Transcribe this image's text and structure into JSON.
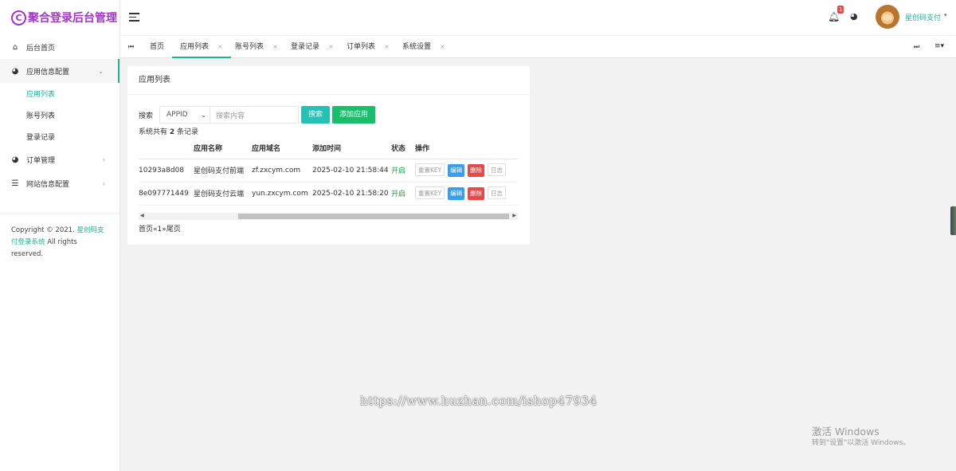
{
  "app": {
    "logo_mark": "C",
    "title": "聚合登录后台管理"
  },
  "sidebar": {
    "items": [
      {
        "label": "后台首页",
        "icon": "home-icon"
      },
      {
        "label": "应用信息配置",
        "icon": "palette-icon",
        "expanded": true
      },
      {
        "label": "订单管理",
        "icon": "palette-icon"
      },
      {
        "label": "网站信息配置",
        "icon": "list-icon"
      }
    ],
    "sub_items": [
      {
        "label": "应用列表",
        "active": true
      },
      {
        "label": "账号列表"
      },
      {
        "label": "登录记录"
      }
    ],
    "copyright_prefix": "Copyright © 2021. ",
    "copyright_link": "星创码支付登录系统",
    "copyright_suffix": " All rights reserved."
  },
  "header": {
    "notification_count": "1",
    "user_name": "星创码支付",
    "user_caret": "▾"
  },
  "tabs": {
    "items": [
      {
        "label": "首页"
      },
      {
        "label": "应用列表",
        "active": true
      },
      {
        "label": "账号列表"
      },
      {
        "label": "登录记录"
      },
      {
        "label": "订单列表"
      },
      {
        "label": "系统设置"
      }
    ]
  },
  "main": {
    "card_title": "应用列表",
    "search_label": "搜索",
    "select_value": "APPID",
    "search_placeholder": "搜索内容",
    "search_button": "搜索",
    "add_button": "添加应用",
    "record_prefix": "系统共有 ",
    "record_count": "2",
    "record_suffix": " 条记录",
    "table": {
      "headers": [
        "",
        "应用名称",
        "应用域名",
        "添加时间",
        "状态",
        "操作"
      ],
      "rows": [
        {
          "appid": "10293a8d08",
          "name": "星创码支付前端",
          "domain": "zf.zxcym.com",
          "time": "2025-02-10 21:58:44",
          "status": "开启"
        },
        {
          "appid": "8e097771449",
          "name": "星创码支付云端",
          "domain": "yun.zxcym.com",
          "time": "2025-02-10 21:58:20",
          "status": "开启"
        }
      ],
      "actions": {
        "reset": "重置KEY",
        "edit": "编辑",
        "delete": "删除",
        "log": "日志"
      }
    },
    "pager": "首页«1»尾页"
  },
  "overlay": {
    "watermark": "https://www.huzhan.com/ishop47934",
    "windows_title": "激活 Windows",
    "windows_sub": "转到\"设置\"以激活 Windows。"
  },
  "colors": {
    "brand": "#a334c8",
    "accent": "#1ab394",
    "danger": "#e64949",
    "primary": "#3a9fe6"
  }
}
